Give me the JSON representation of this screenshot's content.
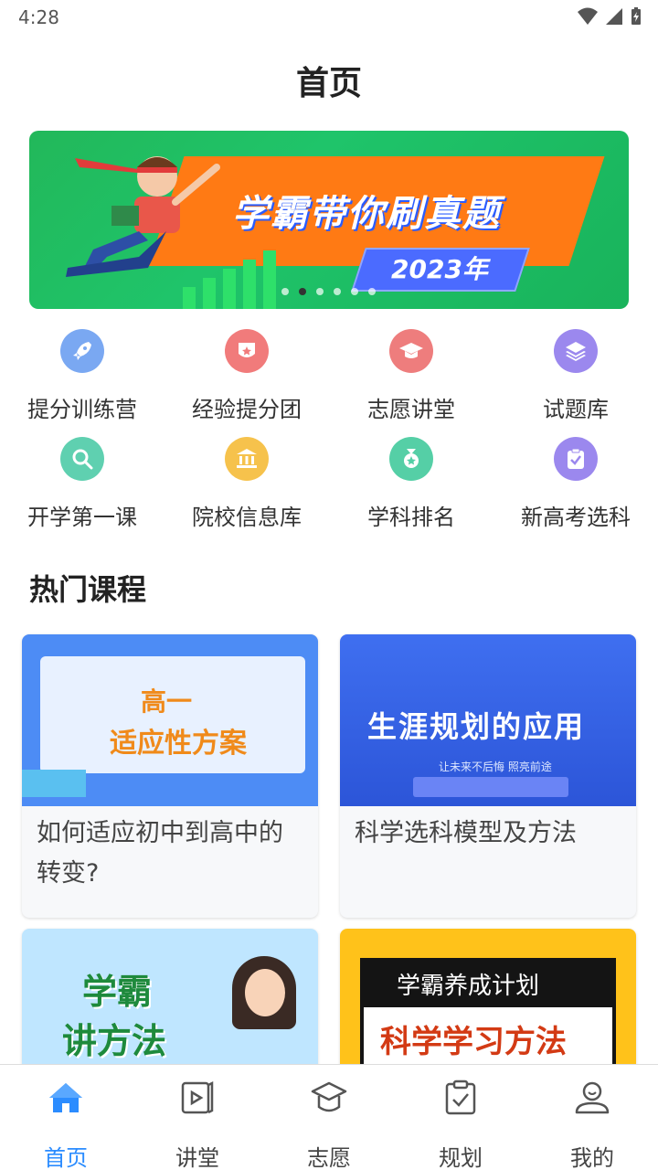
{
  "status": {
    "time": "4:28"
  },
  "header": {
    "title": "首页"
  },
  "banner": {
    "title": "学霸带你刷真题",
    "year": "2023年",
    "page_count": 6,
    "active_index": 1
  },
  "quick_grid": [
    {
      "label": "提分训练营",
      "icon": "rocket-icon",
      "color": "#7aa8f2"
    },
    {
      "label": "经验提分团",
      "icon": "badge-star-icon",
      "color": "#f17b7b"
    },
    {
      "label": "志愿讲堂",
      "icon": "graduation-cap-icon",
      "color": "#ee7d7d"
    },
    {
      "label": "试题库",
      "icon": "layers-icon",
      "color": "#9b88ee"
    },
    {
      "label": "开学第一课",
      "icon": "magnifier-icon",
      "color": "#5fd0b0"
    },
    {
      "label": "院校信息库",
      "icon": "institution-icon",
      "color": "#f6c24c"
    },
    {
      "label": "学科排名",
      "icon": "medal-icon",
      "color": "#55cfa6"
    },
    {
      "label": "新高考选科",
      "icon": "clipboard-check-icon",
      "color": "#9b88ee"
    }
  ],
  "hot_courses": {
    "title": "热门课程",
    "items": [
      {
        "title": "如何适应初中到高中的转变?",
        "image_text": [
          "高一",
          "适应性方案"
        ]
      },
      {
        "title": "科学选科模型及方法",
        "image_text": [
          "生涯规划的应用",
          "让未来不后悔 照亮前途"
        ]
      },
      {
        "title": "",
        "image_text": [
          "学霸",
          "讲方法"
        ]
      },
      {
        "title": "",
        "image_text": [
          "学霸养成计划",
          "科学学习方法"
        ]
      }
    ]
  },
  "tabbar": {
    "items": [
      {
        "label": "首页",
        "icon": "home-icon",
        "active": true
      },
      {
        "label": "讲堂",
        "icon": "video-book-icon",
        "active": false
      },
      {
        "label": "志愿",
        "icon": "graduation-cap-icon",
        "active": false
      },
      {
        "label": "规划",
        "icon": "clipboard-check-icon",
        "active": false
      },
      {
        "label": "我的",
        "icon": "user-icon",
        "active": false
      }
    ],
    "active_color": "#2b8cff"
  }
}
